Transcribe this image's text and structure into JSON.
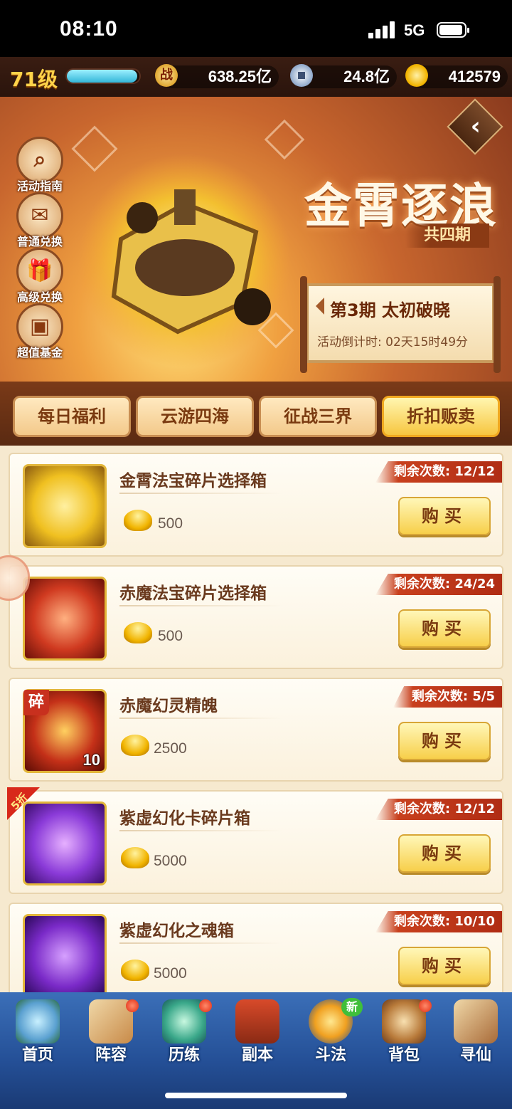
{
  "status_bar": {
    "time": "08:10",
    "network": "5G"
  },
  "top_bar": {
    "level": "71级",
    "xp_fraction": 0.97,
    "power_icon_text": "战",
    "power": "638.25亿",
    "coins": "24.8亿",
    "ingots": "412579"
  },
  "banner": {
    "side_buttons": [
      {
        "label": "活动指南",
        "icon": "magnifier-icon"
      },
      {
        "label": "普通兑换",
        "icon": "gift-icon"
      },
      {
        "label": "高级兑换",
        "icon": "gift-box-icon"
      },
      {
        "label": "超值基金",
        "icon": "treasure-chest-icon"
      }
    ],
    "back_icon": "‹",
    "title": "金霄逐浪",
    "subtitle": "共四期",
    "phase": "第3期  太初破晓",
    "countdown": "活动倒计时: 02天15时49分"
  },
  "tabs": [
    {
      "label": "每日福利",
      "active": false
    },
    {
      "label": "云游四海",
      "active": false
    },
    {
      "label": "征战三界",
      "active": false
    },
    {
      "label": "折扣贩卖",
      "active": true
    }
  ],
  "items": [
    {
      "name": "金霄法宝碎片选择箱",
      "price": "500",
      "remaining": "剩余次数: 12/12",
      "buy_label": "购买",
      "thumb_color": "#f0c020"
    },
    {
      "name": "赤魔法宝碎片选择箱",
      "price": "500",
      "remaining": "剩余次数: 24/24",
      "buy_label": "购买",
      "thumb_color": "#d03a20"
    },
    {
      "name": "赤魔幻灵精魄",
      "price": "2500",
      "remaining": "剩余次数: 5/5",
      "buy_label": "购买",
      "thumb_color": "#c43018",
      "fragment_label": "碎",
      "quantity": "10"
    },
    {
      "name": "紫虚幻化卡碎片箱",
      "price": "5000",
      "remaining": "剩余次数: 12/12",
      "buy_label": "购买",
      "thumb_color": "#8a3ad8",
      "discount": "5折"
    },
    {
      "name": "紫虚幻化之魂箱",
      "price": "5000",
      "remaining": "剩余次数: 10/10",
      "buy_label": "购买",
      "thumb_color": "#7a2ac8"
    }
  ],
  "bottom_nav": [
    {
      "label": "首页",
      "icon": "home-mountain-icon",
      "dot": false
    },
    {
      "label": "阵容",
      "icon": "formation-cards-icon",
      "dot": true
    },
    {
      "label": "历练",
      "icon": "turtle-icon",
      "dot": true
    },
    {
      "label": "副本",
      "icon": "gate-icon",
      "dot": false
    },
    {
      "label": "斗法",
      "icon": "battle-icon",
      "badge": "新"
    },
    {
      "label": "背包",
      "icon": "bag-icon",
      "dot": true
    },
    {
      "label": "寻仙",
      "icon": "scroll-icon",
      "dot": false
    }
  ]
}
